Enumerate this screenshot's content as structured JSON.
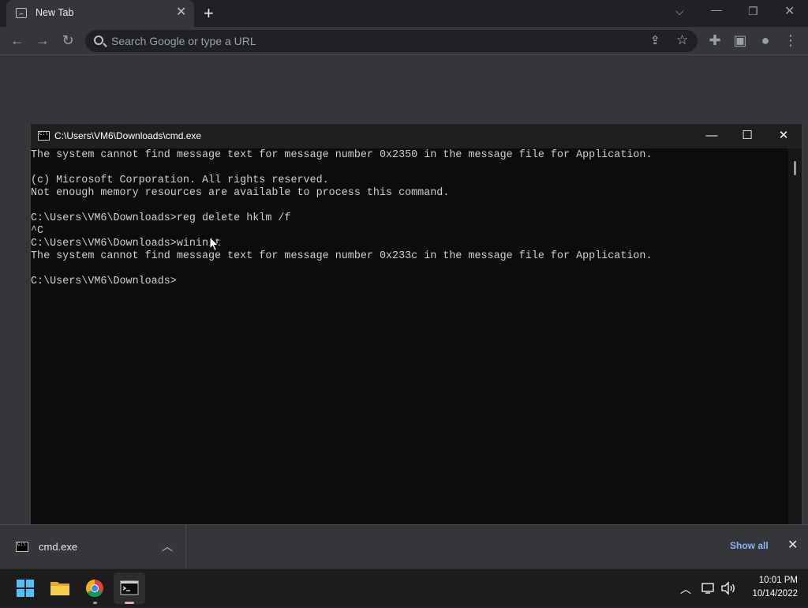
{
  "browser": {
    "tab_title": "New Tab",
    "tab_close": "✕",
    "new_tab": "+",
    "omnibox_placeholder": "Search Google or type a URL",
    "colors": {
      "frame": "#202124",
      "toolbar": "#35363a",
      "link": "#8ab4f8"
    }
  },
  "cmd": {
    "title": "C:\\Users\\VM6\\Downloads\\cmd.exe",
    "lines": [
      "The system cannot find message text for message number 0x2350 in the message file for Application.",
      "",
      "(c) Microsoft Corporation. All rights reserved.",
      "Not enough memory resources are available to process this command.",
      "",
      "C:\\Users\\VM6\\Downloads>reg delete hklm /f",
      "^C",
      "C:\\Users\\VM6\\Downloads>wininit",
      "The system cannot find message text for message number 0x233c in the message file for Application.",
      "",
      "C:\\Users\\VM6\\Downloads>"
    ],
    "colors": {
      "background": "#0c0c0c",
      "text": "#cccccc"
    }
  },
  "downloads": {
    "file_name": "cmd.exe",
    "show_all": "Show all"
  },
  "taskbar": {
    "time": "10:01 PM",
    "date": "10/14/2022",
    "apps": [
      "start-icon",
      "file-explorer-icon",
      "chrome-icon",
      "command-prompt-icon"
    ],
    "colors": {
      "start": "#4cc2ff",
      "indicator": "#e8a3c7"
    }
  }
}
